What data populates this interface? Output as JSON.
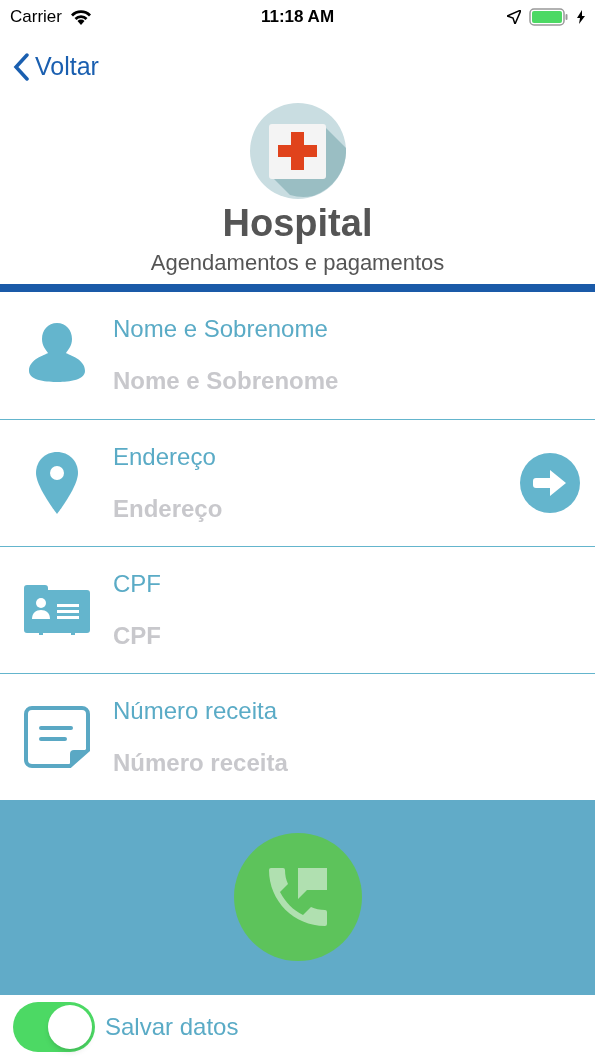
{
  "status_bar": {
    "carrier": "Carrier",
    "time": "11:18 AM"
  },
  "nav": {
    "back": "Voltar"
  },
  "header": {
    "title": "Hospital",
    "subtitle": "Agendamentos e pagamentos"
  },
  "fields": [
    {
      "kind": "person",
      "label": "Nome e Sobrenome",
      "placeholder": "Nome e Sobrenome"
    },
    {
      "kind": "location",
      "label": "Endereço",
      "placeholder": "Endereço"
    },
    {
      "kind": "card",
      "label": "CPF",
      "placeholder": "CPF"
    },
    {
      "kind": "note",
      "label": "Número receita",
      "placeholder": "Número receita"
    }
  ],
  "save_toggle": {
    "label": "Salvar datos",
    "on": true
  }
}
